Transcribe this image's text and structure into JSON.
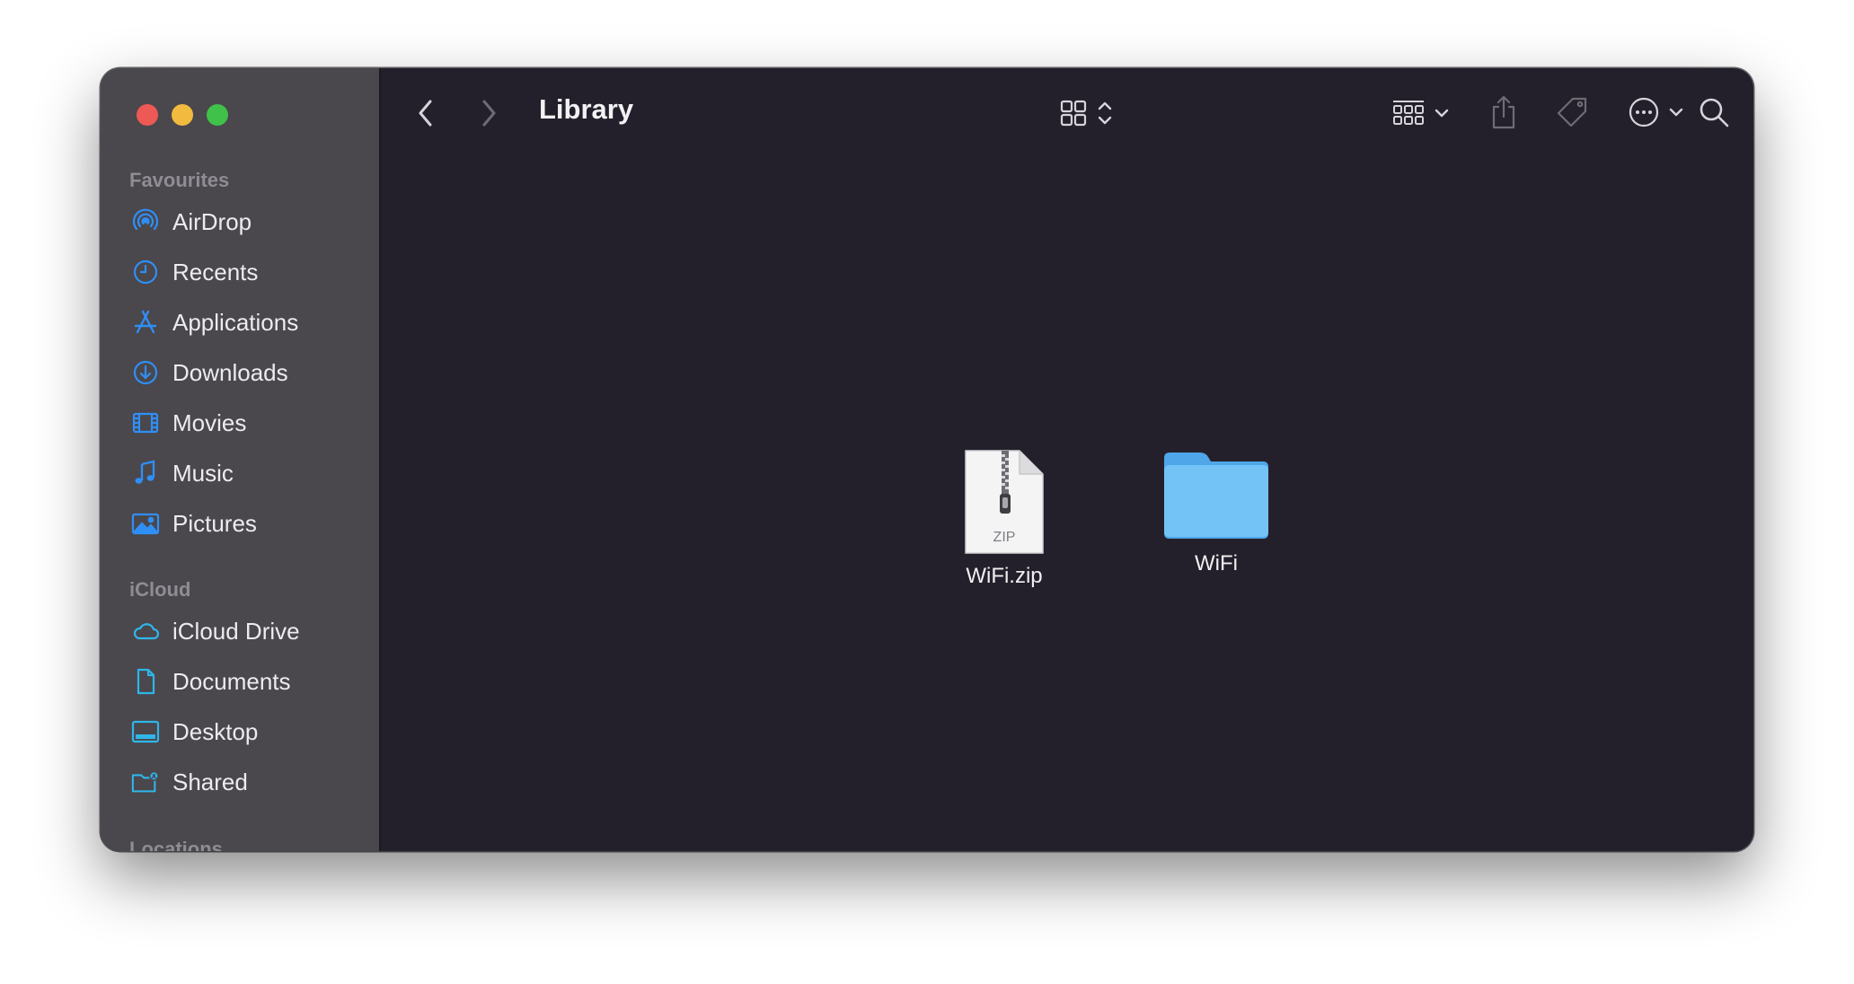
{
  "window": {
    "title": "Library"
  },
  "sidebar": {
    "sections": [
      {
        "header": "Favourites"
      },
      {
        "header": "iCloud"
      },
      {
        "header": "Locations"
      }
    ],
    "favourites": [
      {
        "label": "AirDrop",
        "icon": "airdrop-icon"
      },
      {
        "label": "Recents",
        "icon": "clock-icon"
      },
      {
        "label": "Applications",
        "icon": "applications-icon"
      },
      {
        "label": "Downloads",
        "icon": "download-icon"
      },
      {
        "label": "Movies",
        "icon": "film-icon"
      },
      {
        "label": "Music",
        "icon": "music-note-icon"
      },
      {
        "label": "Pictures",
        "icon": "photo-icon"
      }
    ],
    "icloud": [
      {
        "label": "iCloud Drive",
        "icon": "cloud-icon"
      },
      {
        "label": "Documents",
        "icon": "document-icon"
      },
      {
        "label": "Desktop",
        "icon": "desktop-icon"
      },
      {
        "label": "Shared",
        "icon": "shared-folder-icon"
      }
    ]
  },
  "files": [
    {
      "name": "WiFi.zip",
      "icon": "zip-file-icon",
      "badge": "ZIP"
    },
    {
      "name": "WiFi",
      "icon": "folder-icon"
    }
  ],
  "colors": {
    "accent": "#2f8ff5",
    "sidebar_bg": "#4a474d",
    "content_bg": "#24202b",
    "folder": "#6fc0f6"
  }
}
